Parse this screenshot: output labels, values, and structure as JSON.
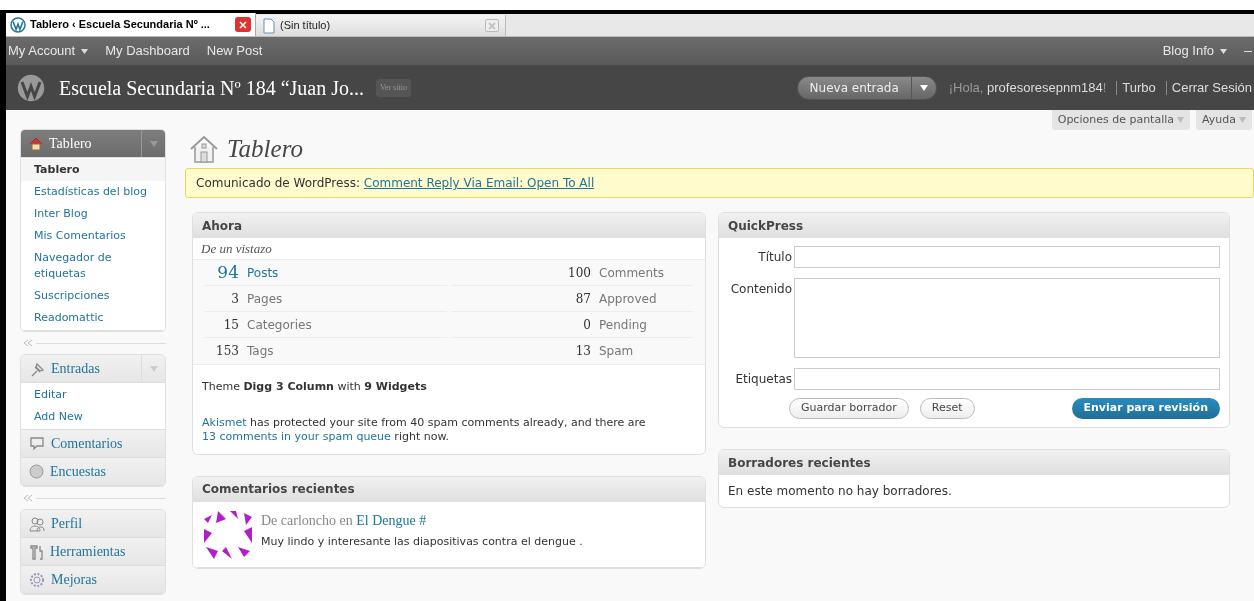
{
  "browser_tabs": [
    {
      "title": "Tablero ‹ Escuela Secundaria Nº ...",
      "selected": true
    },
    {
      "title": "(Sin título)",
      "selected": false
    }
  ],
  "admin_bar": {
    "left": [
      {
        "label": "My Account",
        "dropdown": true
      },
      {
        "label": "My Dashboard",
        "dropdown": false
      },
      {
        "label": "New Post",
        "dropdown": false
      }
    ],
    "right": [
      {
        "label": "Blog Info",
        "dropdown": true
      }
    ]
  },
  "header": {
    "site_title": "Escuela Secundaria Nº 184 “Juan Jo...",
    "view_site": "Ver sitio",
    "new_post_button": "Nueva entrada",
    "greeting_prefix": "¡Hola, ",
    "user": "profesoresepnm184",
    "greeting_suffix": "!",
    "links": [
      "Turbo",
      "Cerrar Sesión"
    ]
  },
  "screen_tabs": [
    "Opciones de pantalla",
    "Ayuda"
  ],
  "sidebar": {
    "groups": [
      {
        "items": [
          {
            "label": "Tablero",
            "selected": true,
            "children": [
              {
                "label": "Tablero",
                "selected": true
              },
              {
                "label": "Estadísticas del blog",
                "selected": false
              },
              {
                "label": "Inter Blog",
                "selected": false
              },
              {
                "label": "Mis Comentarios",
                "selected": false
              },
              {
                "label": "Navegador de etiquetas",
                "selected": false
              },
              {
                "label": "Suscripciones",
                "selected": false
              },
              {
                "label": "Readomattic",
                "selected": false
              }
            ]
          }
        ]
      },
      {
        "items": [
          {
            "label": "Entradas",
            "selected": false,
            "children": [
              {
                "label": "Editar",
                "selected": false
              },
              {
                "label": "Add New",
                "selected": false
              }
            ]
          },
          {
            "label": "Comentarios",
            "selected": false
          },
          {
            "label": "Encuestas",
            "selected": false
          }
        ]
      },
      {
        "items": [
          {
            "label": "Perfil",
            "selected": false
          },
          {
            "label": "Herramientas",
            "selected": false
          },
          {
            "label": "Mejoras",
            "selected": false
          }
        ]
      }
    ]
  },
  "page_title": "Tablero",
  "notice": {
    "prefix": "Comunicado de WordPress: ",
    "link": "Comment Reply Via Email: Open To All"
  },
  "now_panel": {
    "title": "Ahora",
    "subtitle": "De un vistazo",
    "stats_left": [
      {
        "count": "94",
        "label": "Posts",
        "highlight": true
      },
      {
        "count": "3",
        "label": "Pages",
        "highlight": false
      },
      {
        "count": "15",
        "label": "Categories",
        "highlight": false
      },
      {
        "count": "153",
        "label": "Tags",
        "highlight": false
      }
    ],
    "stats_right": [
      {
        "count": "100",
        "label": "Comments"
      },
      {
        "count": "87",
        "label": "Approved"
      },
      {
        "count": "0",
        "label": "Pending"
      },
      {
        "count": "13",
        "label": "Spam"
      }
    ],
    "theme_line": "Theme **Digg 3 Column** with **9 Widgets**",
    "akismet": [
      {
        "text": "Akismet",
        "link": true
      },
      {
        "text": " has protected your site from 40 spam comments already, and there are ",
        "link": false
      },
      {
        "text": "13 comments in your spam queue",
        "link": true
      },
      {
        "text": " right now.",
        "link": false
      }
    ]
  },
  "comments_panel": {
    "title": "Comentarios recientes",
    "comments": [
      {
        "byline": "De carloncho en ",
        "post": "El Dengue #",
        "text": "Muy lindo y interesante las diapositivas contra el dengue ."
      }
    ]
  },
  "quickpress": {
    "title": "QuickPress",
    "fields": [
      {
        "label": "Título",
        "kind": "input"
      },
      {
        "label": "Contenido",
        "kind": "textarea"
      },
      {
        "label": "Etiquetas",
        "kind": "input"
      }
    ],
    "buttons": [
      {
        "label": "Guardar borrador",
        "primary": false
      },
      {
        "label": "Reset",
        "primary": false
      },
      {
        "label": "Enviar para revisión",
        "primary": true
      }
    ]
  },
  "drafts": {
    "title": "Borradores recientes",
    "text": "En este momento no hay borradores."
  }
}
